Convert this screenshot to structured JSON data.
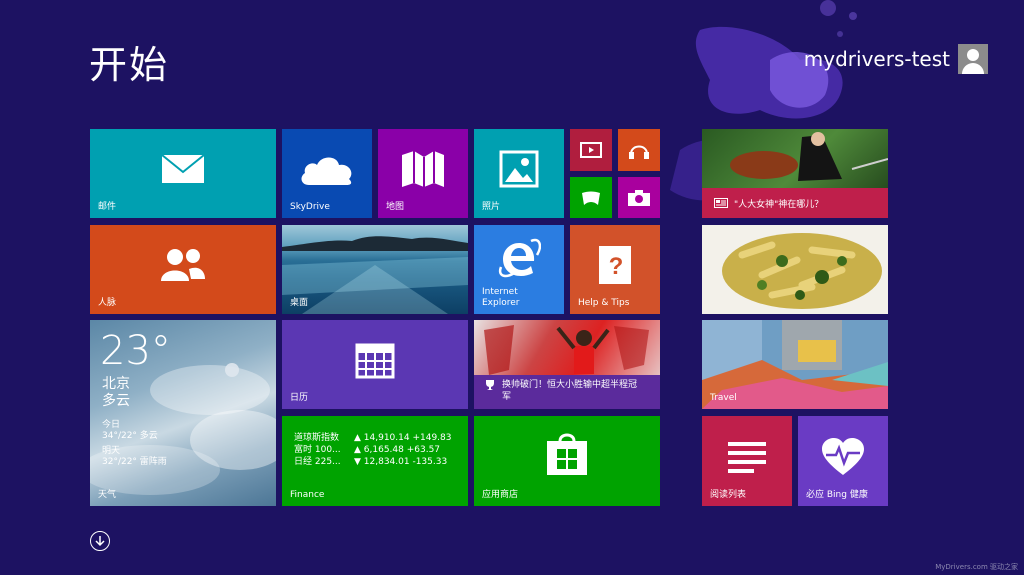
{
  "header": {
    "title": "开始",
    "user_name": "mydrivers-test"
  },
  "tiles": {
    "mail": "邮件",
    "skydrive": "SkyDrive",
    "maps": "地图",
    "photos": "照片",
    "people": "人脉",
    "desktop": "桌面",
    "ie": "Internet\nExplorer",
    "help": "Help & Tips",
    "weather": {
      "temp": "23°",
      "city": "北京",
      "condition": "多云",
      "today_label": "今日",
      "today_value": "34°/22° 多云",
      "tomorrow_label": "明天",
      "tomorrow_value": "32°/22° 雷阵雨",
      "label": "天气"
    },
    "calendar": "日历",
    "sports": {
      "headline": "换帅破门！恒大小胜输中超半程冠军"
    },
    "finance": {
      "rows": [
        {
          "name": "道琼斯指数",
          "value": "▲ 14,910.14 +149.83"
        },
        {
          "name": "富时 100...",
          "value": "▲ 6,165.48 +63.57"
        },
        {
          "name": "日经 225...",
          "value": "▼ 12,834.01 -135.33"
        }
      ],
      "label": "Finance"
    },
    "store": "应用商店",
    "news": {
      "headline": "\"人大女神\"神在哪儿？"
    },
    "travel": "Travel",
    "reading_list": "阅读列表",
    "health": "必应 Bing 健康"
  },
  "footer": {
    "watermark": "MyDrivers.com 驱动之家"
  },
  "colors": {
    "background": "#1d1262",
    "mail": "#00a0b1",
    "skydrive": "#094ab2",
    "maps": "#8a00a8",
    "people": "#d34a1b",
    "ie": "#2b7de1",
    "help": "#d2522a",
    "calendar": "#5b37b3",
    "finance": "#00a300",
    "store": "#00a300",
    "reading": "#bf1f4b",
    "health": "#6a3bc4"
  }
}
